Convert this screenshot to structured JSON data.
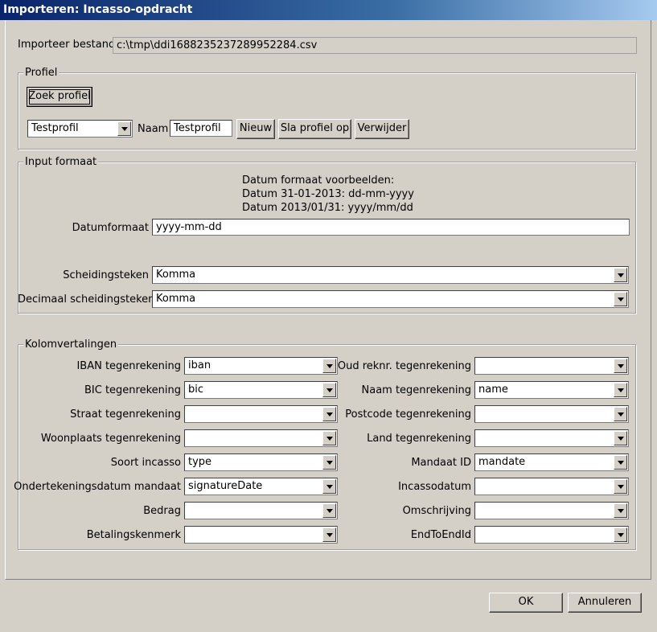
{
  "window": {
    "title": "Importeren: Incasso-opdracht"
  },
  "file": {
    "label": "Importeer bestand",
    "value": "c:\\tmp\\ddi1688235237289952284.csv"
  },
  "profiel": {
    "legend": "Profiel",
    "search_button": "Zoek profiel",
    "selected": "Testprofil",
    "name_label": "Naam",
    "name_value": "Testprofil",
    "new_button": "Nieuw",
    "save_button": "Sla profiel op",
    "delete_button": "Verwijder"
  },
  "input_format": {
    "legend": "Input formaat",
    "examples_title": "Datum formaat voorbeelden:",
    "example1": "Datum 31-01-2013: dd-mm-yyyy",
    "example2": "Datum 2013/01/31: yyyy/mm/dd",
    "date_label": "Datumformaat",
    "date_value": "yyyy-mm-dd",
    "separator_label": "Scheidingsteken",
    "separator_value": "Komma",
    "decimal_label": "Decimaal scheidingsteken",
    "decimal_value": "Komma"
  },
  "columns": {
    "legend": "Kolomvertalingen",
    "left": [
      {
        "label": "IBAN tegenrekening",
        "value": "iban"
      },
      {
        "label": "BIC tegenrekening",
        "value": "bic"
      },
      {
        "label": "Straat tegenrekening",
        "value": ""
      },
      {
        "label": "Woonplaats tegenrekening",
        "value": ""
      },
      {
        "label": "Soort incasso",
        "value": "type"
      },
      {
        "label": "Ondertekeningsdatum mandaat",
        "value": "signatureDate"
      },
      {
        "label": "Bedrag",
        "value": ""
      },
      {
        "label": "Betalingskenmerk",
        "value": ""
      }
    ],
    "right": [
      {
        "label": "Oud reknr. tegenrekening",
        "value": ""
      },
      {
        "label": "Naam tegenrekening",
        "value": "name"
      },
      {
        "label": "Postcode tegenrekening",
        "value": ""
      },
      {
        "label": "Land tegenrekening",
        "value": ""
      },
      {
        "label": "Mandaat ID",
        "value": "mandate"
      },
      {
        "label": "Incassodatum",
        "value": ""
      },
      {
        "label": "Omschrijving",
        "value": ""
      },
      {
        "label": "EndToEndId",
        "value": ""
      }
    ]
  },
  "footer": {
    "ok_button": "OK",
    "cancel_button": "Annuleren"
  }
}
